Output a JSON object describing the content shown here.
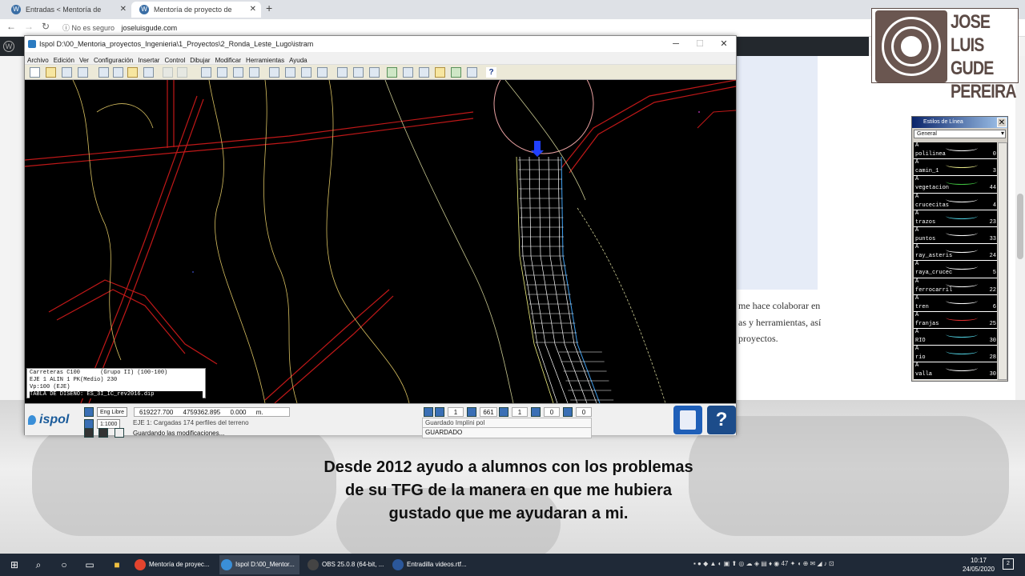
{
  "browser": {
    "tabs": [
      {
        "label": "Entradas < Mentoría de proyecto"
      },
      {
        "label": "Mentoría de proyecto de Ingenie"
      }
    ],
    "new_tab": "+",
    "security": "No es seguro",
    "url": "joseluisgude.com"
  },
  "logo": {
    "line1": "JOSE LUIS",
    "line2": "GUDE",
    "line3": "PEREIRA"
  },
  "page_text": {
    "line1": "me hace colaborar en",
    "line2": "as y herramientas, así",
    "line3": "proyectos."
  },
  "caption": {
    "line1": "Desde 2012 ayudo a alumnos con los problemas",
    "line2": "de su TFG de la manera en que me hubiera",
    "line3": "gustado que me ayudaran a mi."
  },
  "ispol": {
    "title": "Ispol  D:\\00_Mentoria_proyectos_Ingenieria\\1_Proyectos\\2_Ronda_Leste_Lugo\\istram",
    "menu": [
      "Archivo",
      "Edición",
      "Ver",
      "Configuración",
      "Insertar",
      "Control",
      "Dibujar",
      "Modificar",
      "Herramientas",
      "Ayuda"
    ],
    "console": [
      "Carreteras C100      (Grupo II) (100-100)",
      "EJE 1 ALIN 1 PK(Medio) 230",
      "Vp:100 (EJE)",
      "TABLA DE DISEÑO: ES_3I_IC_rev2016.dip"
    ],
    "status": {
      "logo_text": "ispol",
      "eng_libre": "Eng Libre",
      "scale": "1:1000",
      "x": "619227.700",
      "y": "4759362.895",
      "z": "0.000",
      "unit": "m.",
      "val1": "1",
      "val2": "661",
      "val3": "1",
      "val4": "0",
      "val5": "0",
      "msg1": "EJE 1: Cargadas 174 perfiles del terreno",
      "msg2": "Guardando las modificaciones...",
      "msg3": "Guardado Implíni pol",
      "msg4": "GUARDADO",
      "help": "?"
    }
  },
  "estilos": {
    "title": "Estilos de Línea",
    "selected": "General",
    "items": [
      {
        "name": "polilinea",
        "count": "0",
        "color": "#ffffff"
      },
      {
        "name": "camin_1",
        "count": "3",
        "color": "#e8e888"
      },
      {
        "name": "vegetacion",
        "count": "44",
        "color": "#3fbf3f"
      },
      {
        "name": "crucecitas",
        "count": "4",
        "color": "#ffffff"
      },
      {
        "name": "trazos",
        "count": "23",
        "color": "#4fd0e0"
      },
      {
        "name": "puntos",
        "count": "33",
        "color": "#ffffff"
      },
      {
        "name": "ray_asteris",
        "count": "24",
        "color": "#ffffff"
      },
      {
        "name": "raya_crucec",
        "count": "5",
        "color": "#ffffff"
      },
      {
        "name": "ferrocarril",
        "count": "22",
        "color": "#ffffff"
      },
      {
        "name": "tren",
        "count": "6",
        "color": "#ffffff"
      },
      {
        "name": "franjas",
        "count": "25",
        "color": "#e03030"
      },
      {
        "name": "RIO",
        "count": "30",
        "color": "#4fd0e0"
      },
      {
        "name": "rio",
        "count": "28",
        "color": "#4fd0e0"
      },
      {
        "name": "valla",
        "count": "30",
        "color": "#ffffff"
      }
    ]
  },
  "taskbar": {
    "apps": [
      {
        "label": "Mentoría de proyec...",
        "color": "#e4442e"
      },
      {
        "label": "Ispol  D:\\00_Mentor...",
        "color": "#3a8fd8"
      },
      {
        "label": "OBS 25.0.8 (64-bit, ...",
        "color": "#444444"
      },
      {
        "label": "Entradilla videos.rtf...",
        "color": "#2b579a"
      }
    ],
    "time": "10:17",
    "date": "24/05/2020",
    "notifications": "2"
  }
}
